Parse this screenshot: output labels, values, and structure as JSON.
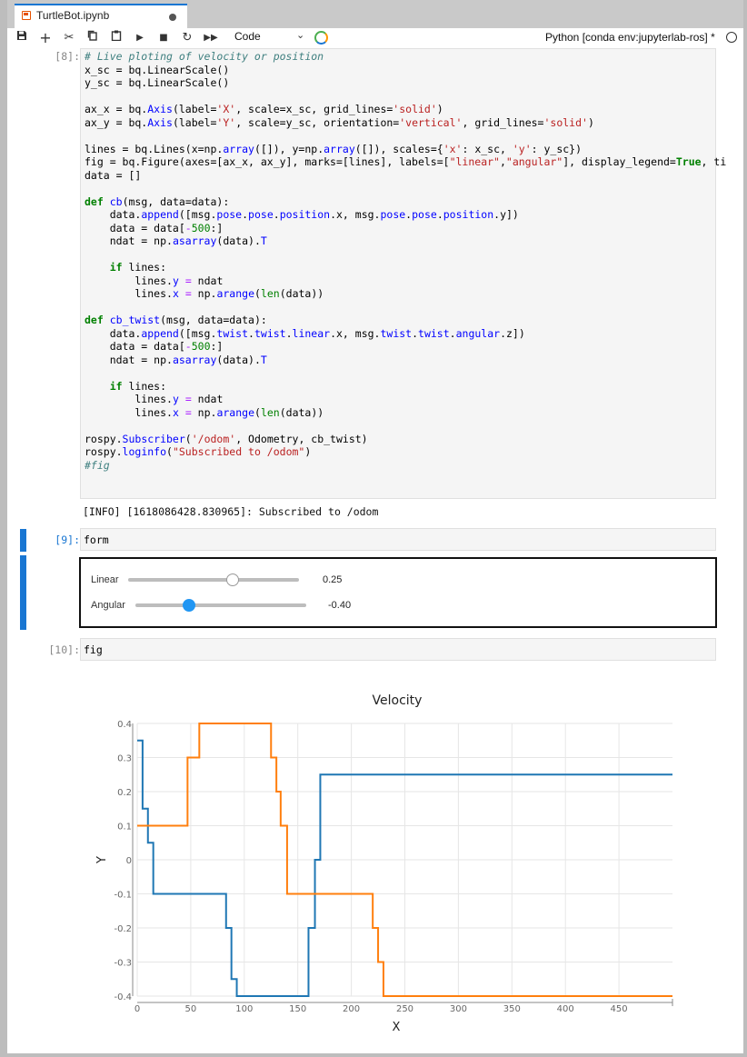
{
  "tab": {
    "title": "TurtleBot.ipynb"
  },
  "toolbar": {
    "cell_type": "Code",
    "kernel": "Python [conda env:jupyterlab-ros] *"
  },
  "cells": [
    {
      "prompt": "[8]:"
    },
    {
      "prompt": "[9]:",
      "code": "form"
    },
    {
      "prompt": "[10]:",
      "code": "fig"
    }
  ],
  "output_8": "[INFO] [1618086428.830965]: Subscribed to /odom",
  "form": {
    "linear_label": "Linear",
    "linear_value": "0.25",
    "linear_fraction": 0.62,
    "angular_label": "Angular",
    "angular_value": "-0.40",
    "angular_fraction": 0.3
  },
  "colors": {
    "linear": "#1f77b4",
    "angular": "#ff7f0e",
    "accent": "#1976d2"
  },
  "chart_data": {
    "type": "line",
    "title": "Velocity",
    "xlabel": "X",
    "ylabel": "Y",
    "xlim": [
      0,
      500
    ],
    "ylim": [
      -0.4,
      0.4
    ],
    "x_ticks": [
      0,
      50,
      100,
      150,
      200,
      250,
      300,
      350,
      400,
      450
    ],
    "y_ticks": [
      0.4,
      0.3,
      0.2,
      0.1,
      0,
      -0.1,
      -0.2,
      -0.3,
      -0.4
    ],
    "grid": true,
    "series": [
      {
        "name": "",
        "color": "#1f77b4",
        "step": true,
        "x": [
          0,
          5,
          10,
          15,
          20,
          83,
          88,
          93,
          101,
          160,
          166,
          171,
          174,
          500
        ],
        "y": [
          0.35,
          0.15,
          0.05,
          -0.1,
          -0.1,
          -0.2,
          -0.35,
          -0.4,
          -0.4,
          -0.2,
          0.0,
          0.25,
          0.25,
          0.25
        ]
      },
      {
        "name": "",
        "color": "#ff7f0e",
        "step": true,
        "x": [
          0,
          47,
          52,
          58,
          125,
          130,
          134,
          140,
          145,
          220,
          225,
          230,
          500
        ],
        "y": [
          0.1,
          0.3,
          0.3,
          0.4,
          0.3,
          0.2,
          0.1,
          -0.1,
          -0.1,
          -0.2,
          -0.3,
          -0.4,
          -0.4
        ]
      }
    ]
  }
}
